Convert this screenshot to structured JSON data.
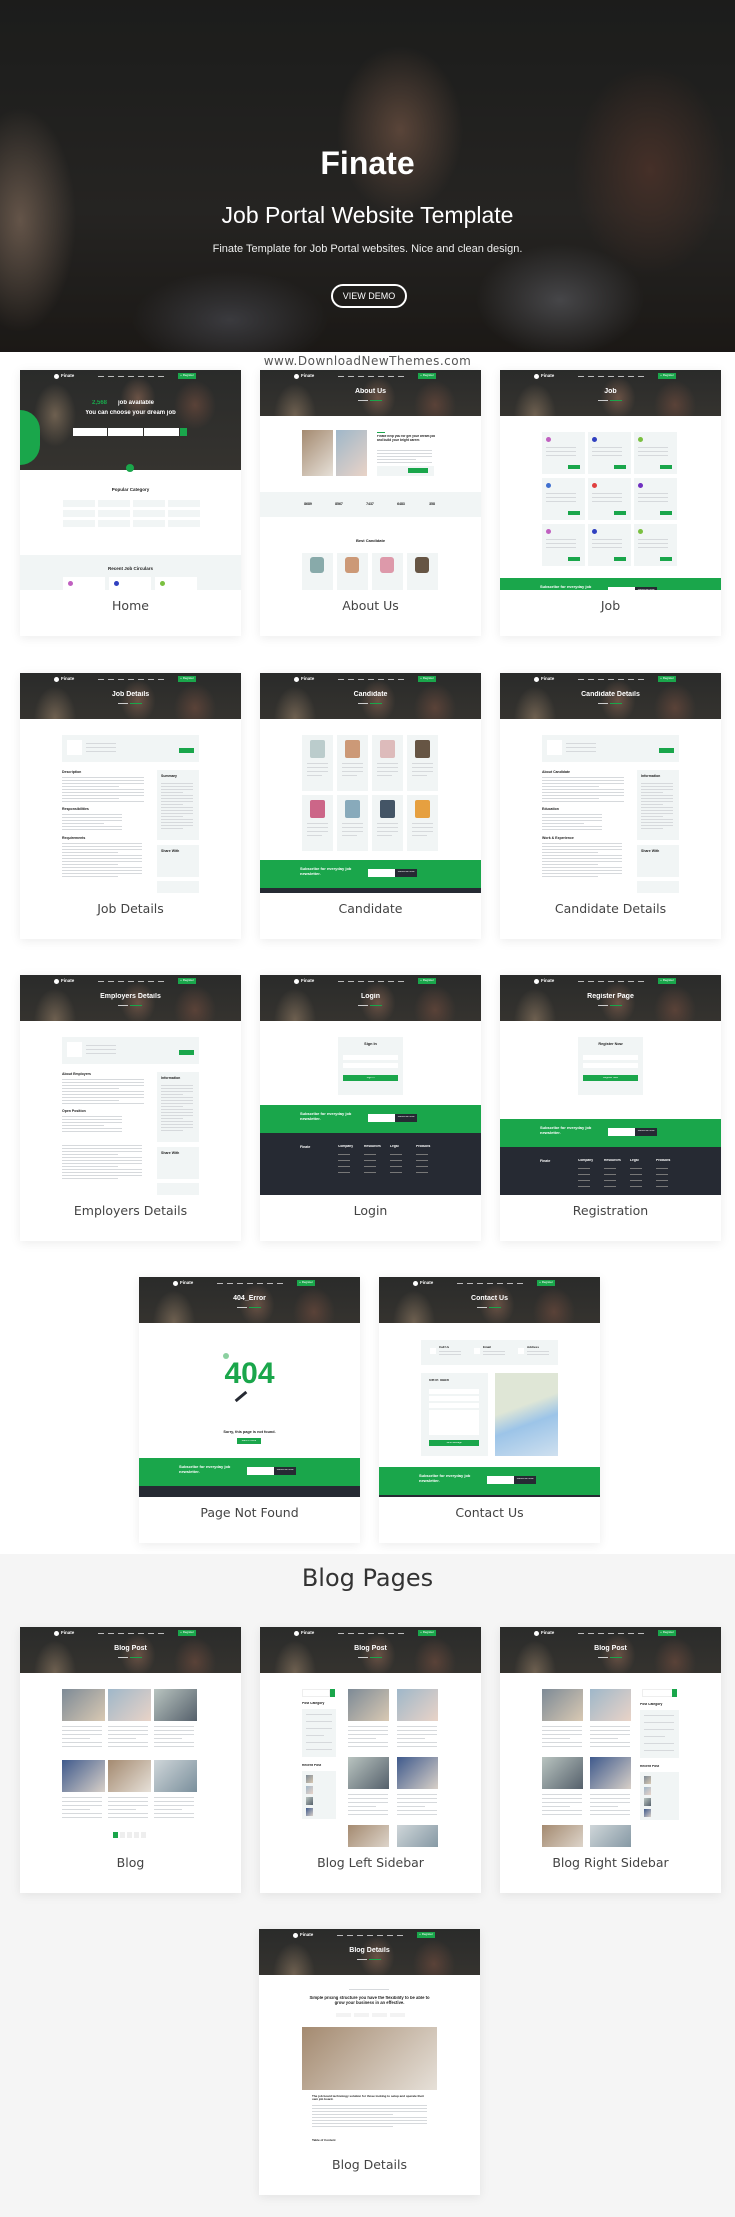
{
  "hero": {
    "title": "Finate",
    "subtitle": "Job Portal Website Template",
    "description": "Finate Template for Job Portal websites. Nice and clean design.",
    "button_label": "VIEW DEMO"
  },
  "watermark": "www.DownloadNewThemes.com",
  "blog_heading": "Blog Pages",
  "colors": {
    "accent": "#1aa64b",
    "dark": "#262a33",
    "light_panel": "#f1f5f5",
    "section_bg": "#f5f5f5"
  },
  "thumb_common": {
    "logo": "Finate",
    "register": "+ Register",
    "subscribe": "Subscribe for everyday job newsletter.",
    "subscribe_btn": "Subscribe Now",
    "footer_cols": [
      "Company",
      "Resources",
      "Legal",
      "Products"
    ]
  },
  "cards": [
    {
      "label": "Home",
      "kind": "home",
      "texts": {
        "count": "2,568",
        "headline": "job available",
        "headline2": "You can choose your dream job",
        "h1": "Popular Category",
        "h2": "Recent Job Circulars"
      }
    },
    {
      "label": "About Us",
      "kind": "about",
      "texts": {
        "title": "About Us",
        "h1": "Finate help you for get your dream job and build your bright career.",
        "stats": [
          "8689",
          "8567",
          "7437",
          "6483",
          "358"
        ],
        "h2": "Best Candidate"
      }
    },
    {
      "label": "Job",
      "kind": "grid3",
      "texts": {
        "title": "Job"
      }
    },
    {
      "label": "Job Details",
      "kind": "detail",
      "texts": {
        "title": "Job Details",
        "h1": "Description",
        "h2": "Responsibilities",
        "h3": "Requirements",
        "side": "Summary",
        "side2": "Share With"
      }
    },
    {
      "label": "Candidate",
      "kind": "grid4",
      "texts": {
        "title": "Candidate"
      }
    },
    {
      "label": "Candidate Details",
      "kind": "detail",
      "texts": {
        "title": "Candidate Details",
        "h1": "About Candidate",
        "h2": "Education",
        "h3": "Work & Experience",
        "side": "Information",
        "side2": "Share With"
      }
    },
    {
      "label": "Employers Details",
      "kind": "detail",
      "texts": {
        "title": "Employers Details",
        "h1": "About Employers",
        "h2": "Open Position",
        "h3": "",
        "side": "Information",
        "side2": "Share With"
      }
    },
    {
      "label": "Login",
      "kind": "form",
      "texts": {
        "title": "Login",
        "h1": "Sign In",
        "btn": "Sign In"
      }
    },
    {
      "label": "Registration",
      "kind": "form",
      "texts": {
        "title": "Register Page",
        "h1": "Register Now",
        "btn": "Register Now"
      }
    },
    {
      "label": "Page Not Found",
      "kind": "notfound",
      "texts": {
        "title": "404_Error",
        "big": "404",
        "h1": "Sorry, this page is not found.",
        "btn": "Back to Home"
      }
    },
    {
      "label": "Contact Us",
      "kind": "contact",
      "texts": {
        "title": "Contact Us",
        "i1": "Call Us",
        "i2": "Email",
        "i3": "Address",
        "h1": "Get in Touch",
        "btn": "Send Message"
      }
    },
    {
      "label": "Blog",
      "kind": "blog",
      "texts": {
        "title": "Blog Post"
      }
    },
    {
      "label": "Blog Left Sidebar",
      "kind": "blogleft",
      "texts": {
        "title": "Blog Post",
        "s1": "Post Category",
        "s2": "Recent Post"
      }
    },
    {
      "label": "Blog Right Sidebar",
      "kind": "blogright",
      "texts": {
        "title": "Blog Post",
        "s1": "Post Category",
        "s2": "Recent Post"
      }
    },
    {
      "label": "Blog Details",
      "kind": "blogdetails",
      "texts": {
        "title": "Blog Details",
        "h1": "Simple pricing structure you have the flexibility to be able to grow your business in an effective.",
        "h2": "The job board technology solution for those looking to setup and operate their own job board.",
        "h3": "Table of Content"
      }
    }
  ]
}
